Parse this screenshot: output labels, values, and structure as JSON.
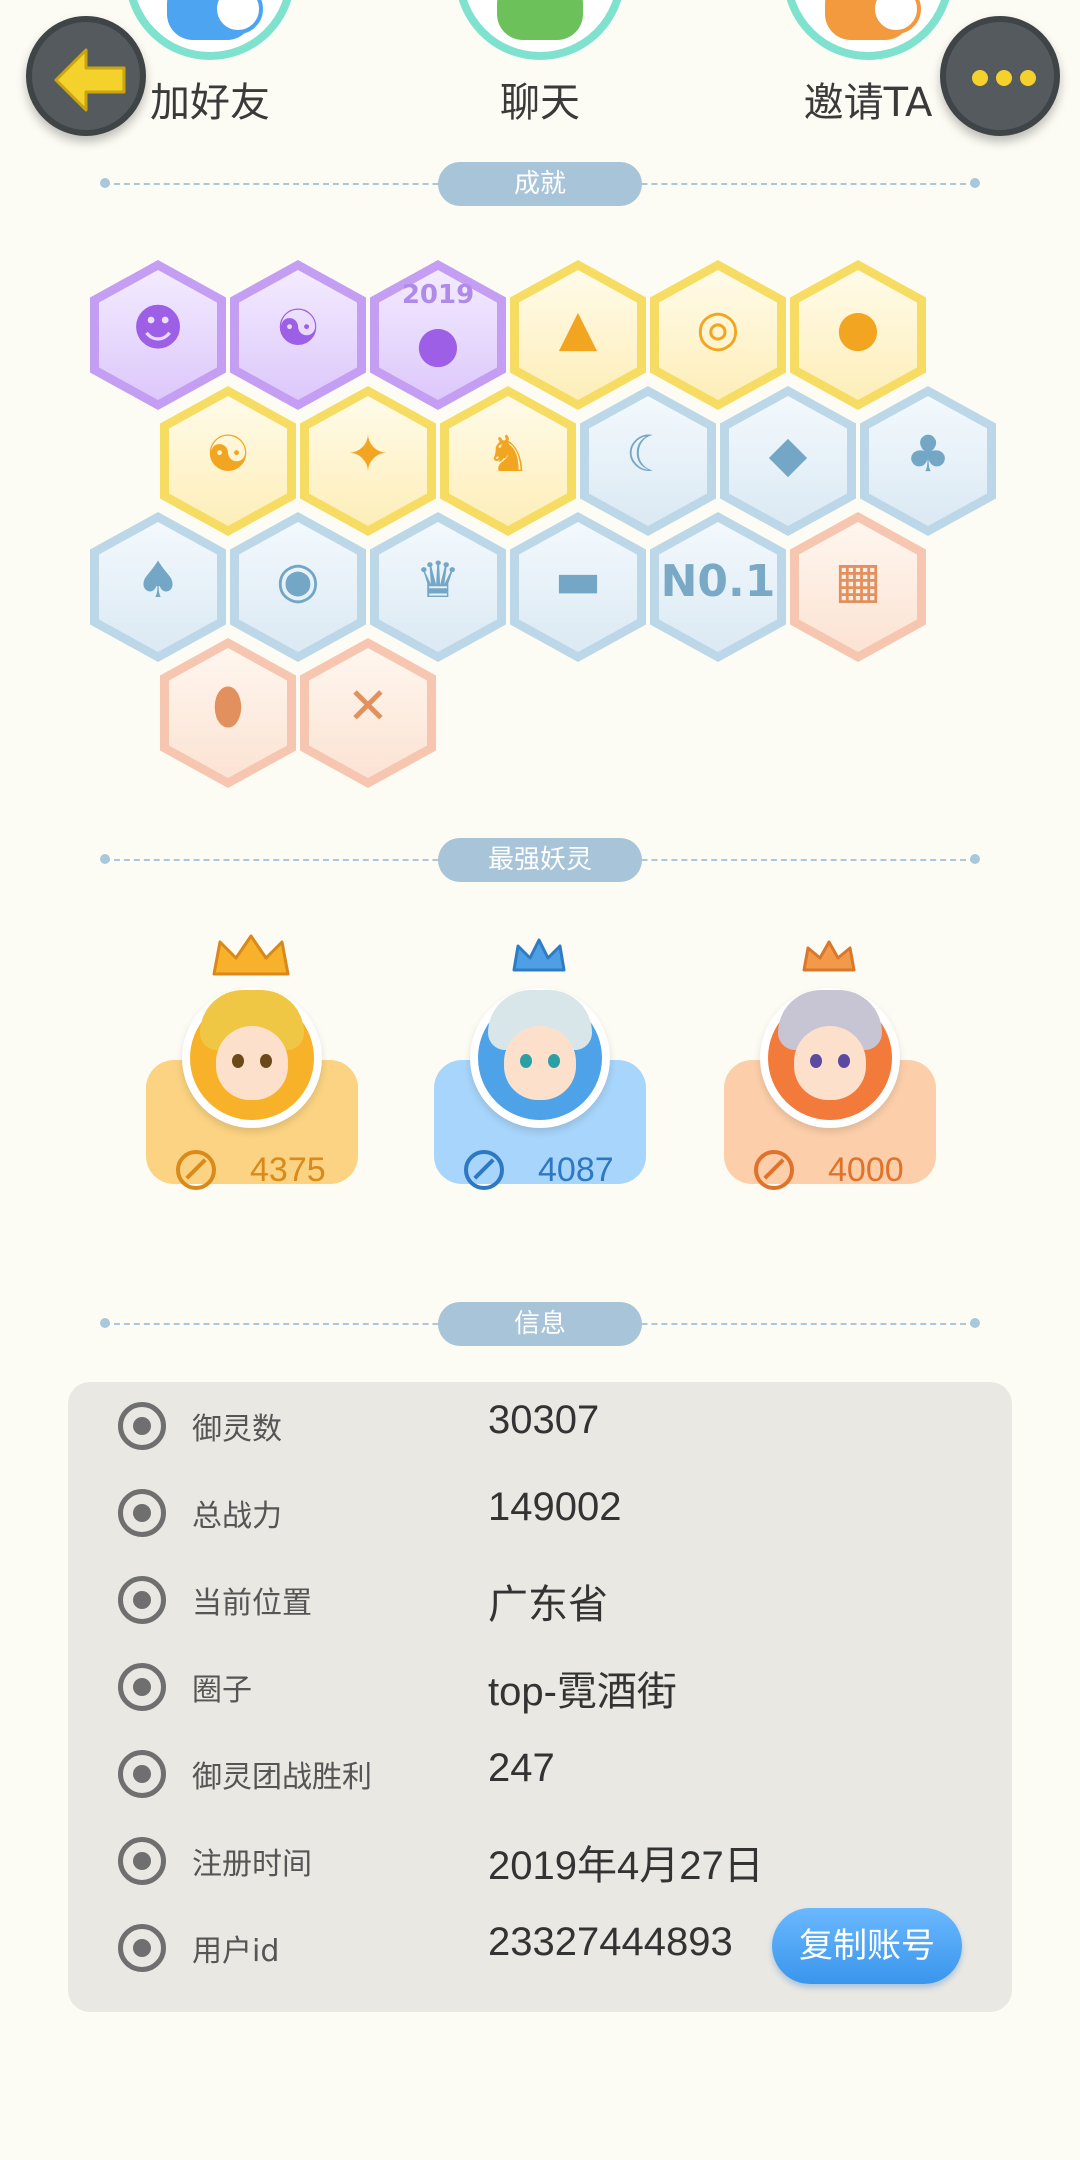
{
  "actions": {
    "add_friend": "加好友",
    "chat": "聊天",
    "invite": "邀请TA"
  },
  "sections": {
    "achievements": "成就",
    "strongest_spirits": "最强妖灵",
    "info": "信息"
  },
  "achievements": {
    "badge_year_text": "2019",
    "badge_no1_text": "N0.1"
  },
  "strongest_spirits": [
    {
      "power": "4375",
      "theme": "gold"
    },
    {
      "power": "4087",
      "theme": "blue"
    },
    {
      "power": "4000",
      "theme": "peach"
    }
  ],
  "info": {
    "rows": [
      {
        "key": "御灵数",
        "value": "30307",
        "icon": "spirit-icon"
      },
      {
        "key": "总战力",
        "value": "149002",
        "icon": "sword-icon"
      },
      {
        "key": "当前位置",
        "value": "广东省",
        "icon": "location-icon"
      },
      {
        "key": "圈子",
        "value": "top-霓酒街",
        "icon": "circle-icon"
      },
      {
        "key": "御灵团战胜利",
        "value": "247",
        "icon": "trophy-icon"
      },
      {
        "key": "注册时间",
        "value": "2019年4月27日",
        "icon": "clock-icon"
      },
      {
        "key": "用户id",
        "value": "23327444893",
        "icon": "id-card-icon"
      }
    ],
    "copy_button": "复制账号"
  },
  "colors": {
    "background": "#fdfcf4",
    "section_pill": "#a8c4d8",
    "action_ring": "#7fe2cf",
    "copy_button": "#3a96ec",
    "more_dots": "#f5d22b"
  }
}
